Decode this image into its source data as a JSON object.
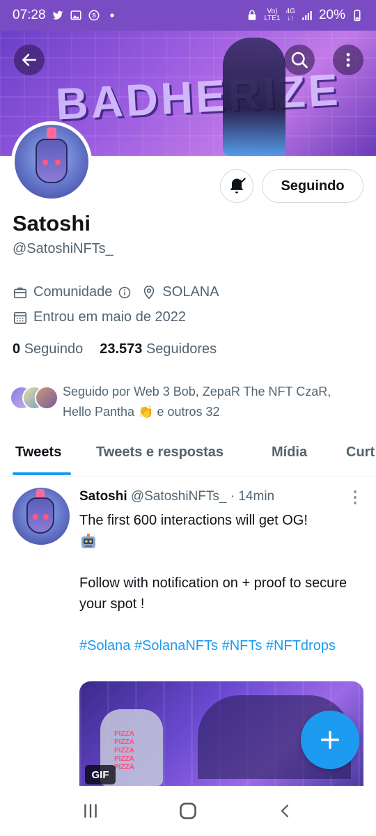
{
  "status_bar": {
    "time": "07:28",
    "signal_text_top": "Vo)",
    "signal_text_bottom": "LTE1",
    "network_top": "4G",
    "network_bottom": "↓↑",
    "battery": "20%",
    "icons": [
      "twitter-icon",
      "gallery-icon",
      "app-icon",
      "dot-icon",
      "lock-icon",
      "signal-icon",
      "battery-icon"
    ]
  },
  "banner": {
    "art_text": "BADHERIZE",
    "icons": [
      "back-arrow-icon",
      "search-icon",
      "more-vertical-icon"
    ]
  },
  "profile": {
    "name": "Satoshi",
    "handle": "@SatoshiNFTs_",
    "category": "Comunidade",
    "location": "SOLANA",
    "joined": "Entrou em maio de 2022",
    "following_count": "0",
    "following_label": "Seguindo",
    "followers_count": "23.573",
    "followers_label": "Seguidores",
    "followed_by": "Seguido por Web 3 Bob, ZepaR The NFT CzaR, Hello Pantha 👏 e outros 32"
  },
  "actions": {
    "follow_button": "Seguindo"
  },
  "tabs": [
    "Tweets",
    "Tweets e respostas",
    "Mídia",
    "Curt"
  ],
  "active_tab": 0,
  "tweet": {
    "name": "Satoshi",
    "handle": "@SatoshiNFTs_",
    "separator": "·",
    "time": "14min",
    "line1": "The first 600 interactions will get OG!",
    "line2": "Follow with notification on + proof to secure your spot !",
    "hashtags": "#Solana #SolanaNFTs #NFTs #NFTdrops",
    "media_badge": "GIF",
    "media_text": "PIZZA PIZZA PIZZA PIZZA PIZZA"
  },
  "colors": {
    "accent": "#1d9bf0",
    "status_bar": "#7a4cc4",
    "text_primary": "#0f1419",
    "text_secondary": "#536471"
  }
}
